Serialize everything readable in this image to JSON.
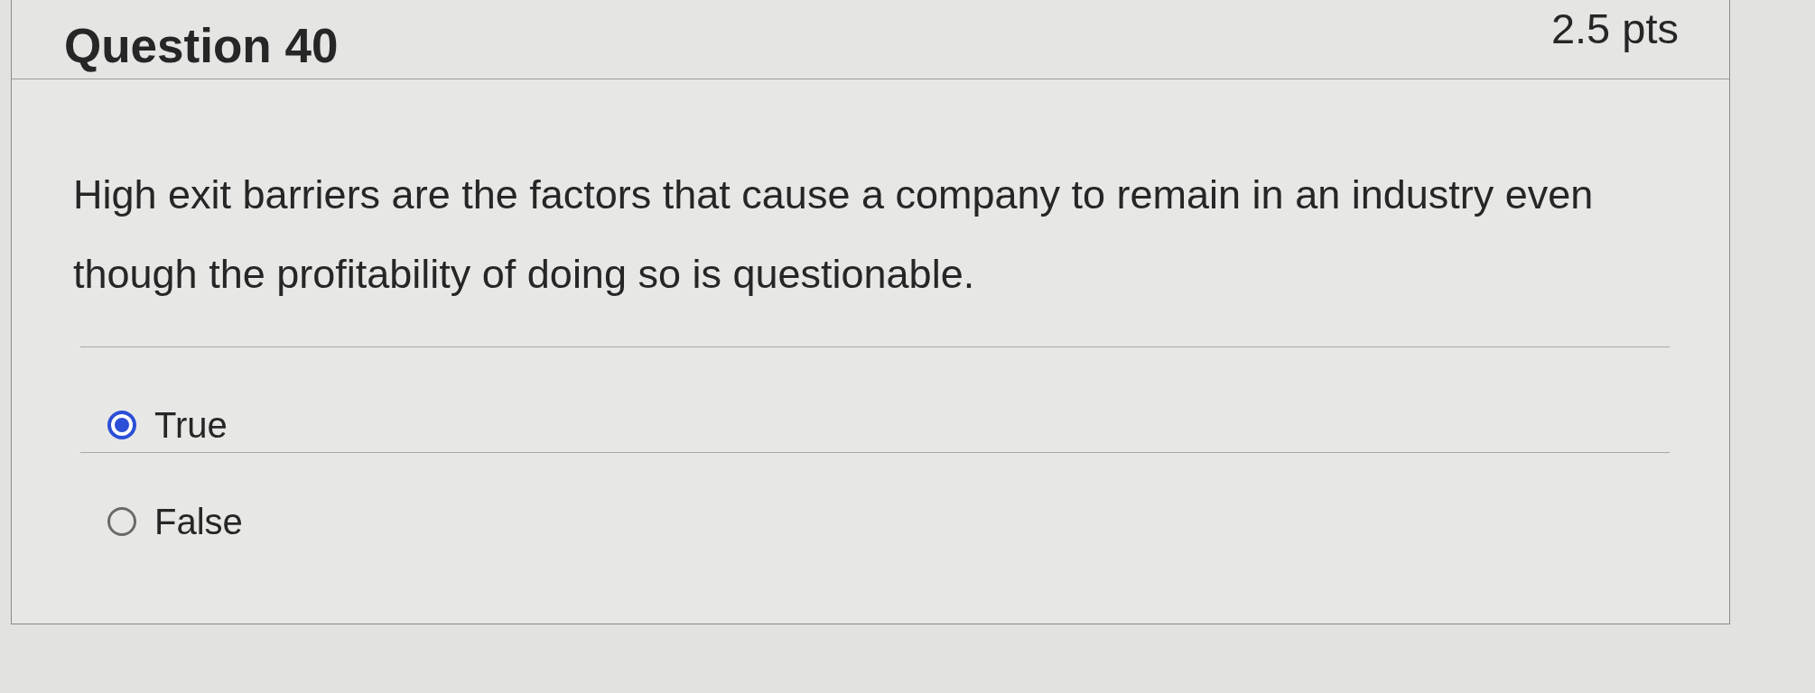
{
  "question": {
    "title": "Question 40",
    "points": "2.5 pts",
    "text": "High exit barriers are the factors that cause a company to remain in an industry even though the profitability of doing so is questionable.",
    "answers": [
      {
        "label": "True",
        "selected": true
      },
      {
        "label": "False",
        "selected": false
      }
    ]
  }
}
